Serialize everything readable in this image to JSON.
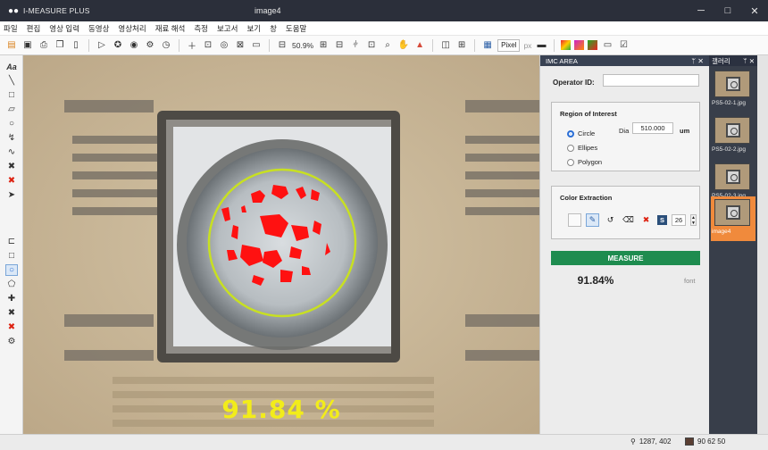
{
  "titlebar": {
    "app_title": "I-MEASURE PLUS",
    "doc_title": "image4",
    "minimize": "─",
    "maximize": "□",
    "close": "✕"
  },
  "menu": [
    "파일",
    "편집",
    "영상 입력",
    "동영상",
    "영상처리",
    "재료 해석",
    "측정",
    "보고서",
    "보기",
    "창",
    "도움말"
  ],
  "toolbar": {
    "zoom": "50.9%",
    "unit_select": "Pixel",
    "unit_suffix": "px"
  },
  "viewport": {
    "overlay_result": "91.84 %"
  },
  "panel": {
    "title": "IMC AREA",
    "pin": "ᛘ ✕",
    "operator_label": "Operator ID:",
    "operator_value": "",
    "roi": {
      "title": "Region of Interest",
      "options": [
        "Circle",
        "Ellipes",
        "Polygon"
      ],
      "selected": "Circle",
      "dia_label": "Dia",
      "dia_value": "510.000",
      "dia_unit": "um"
    },
    "color_extraction": {
      "title": "Color Extraction",
      "s_label": "S",
      "s_value": "26"
    },
    "measure_label": "MEASURE",
    "result_value": "91.84%",
    "result_unit": "font"
  },
  "gallery": {
    "title": "갤러리",
    "pin": "ᛘ ✕",
    "items": [
      {
        "label": "PS5-02-1.jpg"
      },
      {
        "label": "PS5-02-2.jpg"
      },
      {
        "label": "PS5-02-3.jpg"
      },
      {
        "label": "image4"
      }
    ],
    "active": "image4"
  },
  "status": {
    "coords": "1287, 402",
    "rgb": "90 62 50"
  },
  "colors": {
    "overlay_text": "#f2ec1a",
    "roi_circle": "#c8e021",
    "extraction": "#ff0000",
    "measure_button": "#1e8c4f",
    "gallery_active": "#f08a3c"
  }
}
